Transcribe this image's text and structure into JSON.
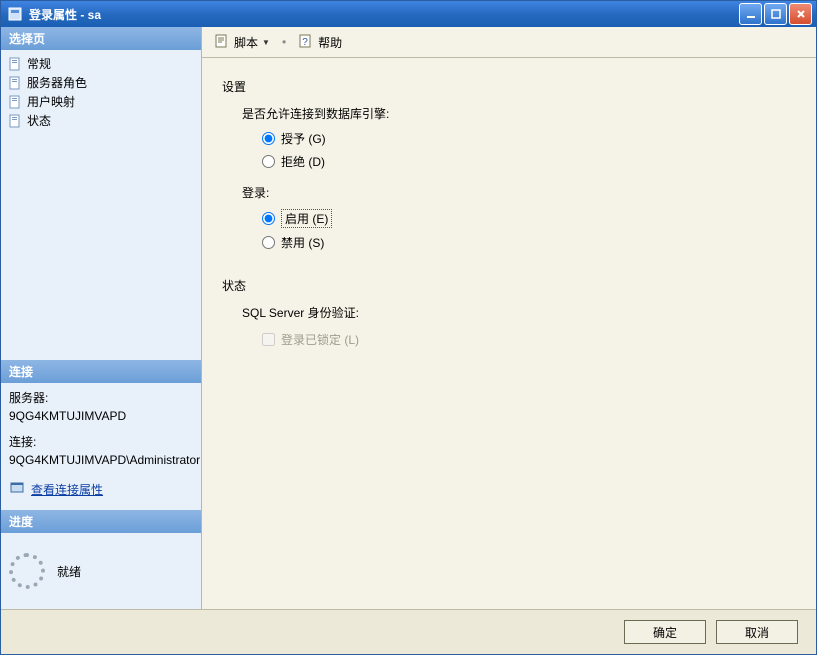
{
  "window": {
    "title": "登录属性 - sa"
  },
  "sidebar": {
    "header_select": "选择页",
    "nav": [
      {
        "label": "常规"
      },
      {
        "label": "服务器角色"
      },
      {
        "label": "用户映射"
      },
      {
        "label": "状态"
      }
    ],
    "header_conn": "连接",
    "conn": {
      "server_label": "服务器:",
      "server_value": "9QG4KMTUJIMVAPD",
      "conn_label": "连接:",
      "conn_value": "9QG4KMTUJIMVAPD\\Administrator",
      "view_link": "查看连接属性"
    },
    "header_progress": "进度",
    "progress": {
      "status": "就绪"
    }
  },
  "toolbar": {
    "script_label": "脚本",
    "help_label": "帮助"
  },
  "content": {
    "settings_title": "设置",
    "connect_q": "是否允许连接到数据库引擎:",
    "grant": "授予 (G)",
    "deny": "拒绝 (D)",
    "login_title": "登录:",
    "enable": "启用 (E)",
    "disable": "禁用 (S)",
    "status_title": "状态",
    "sql_auth": "SQL Server 身份验证:",
    "locked": "登录已锁定 (L)"
  },
  "buttons": {
    "ok": "确定",
    "cancel": "取消"
  }
}
